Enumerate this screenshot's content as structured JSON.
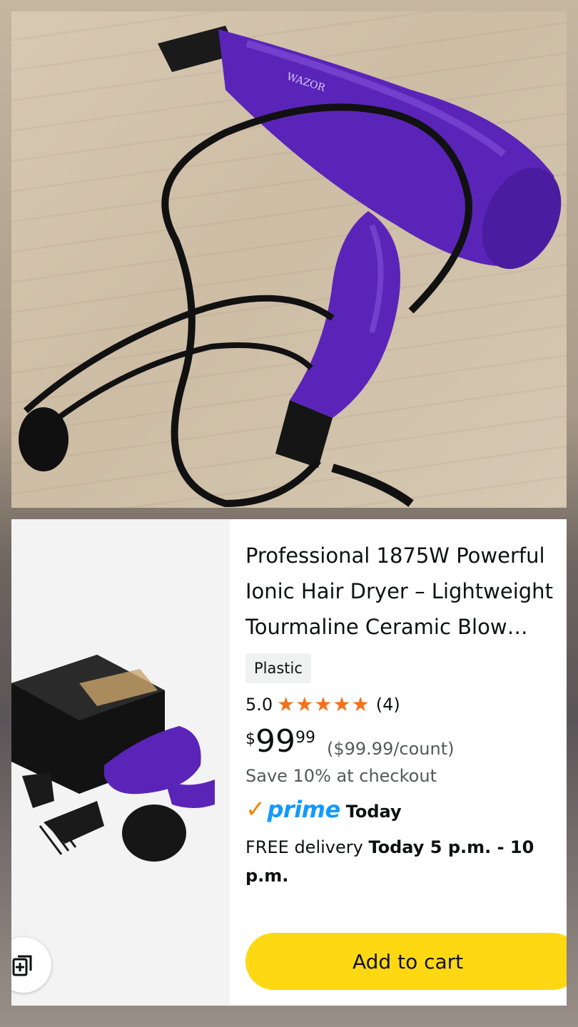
{
  "hero": {
    "alt_icon": "hair-dryer-photo",
    "brand_on_product": "WAZOR"
  },
  "product": {
    "title_line1": "Professional 1875W Powerful",
    "title_line2": "Ionic Hair Dryer – Lightweight",
    "title_line3": "Tourmaline Ceramic Blow…",
    "material_badge": "Plastic",
    "rating_value": "5.0",
    "rating_stars": 5,
    "rating_count": "(4)",
    "price_symbol": "$",
    "price_whole": "99",
    "price_fraction": "99",
    "unit_price": "($99.99/count)",
    "savings": "Save 10% at checkout",
    "prime_label": "prime",
    "prime_day": "Today",
    "delivery_prefix": "FREE delivery ",
    "delivery_window": "Today 5 p.m. - 10 p.m."
  },
  "actions": {
    "add_to_cart": "Add to cart",
    "compare_icon": "compare-icon"
  },
  "colors": {
    "cart_button": "#ffd814",
    "prime_blue": "#1399ff",
    "prime_check": "#f08804",
    "star": "#f3721a",
    "dryer_purple": "#5b24b8"
  }
}
